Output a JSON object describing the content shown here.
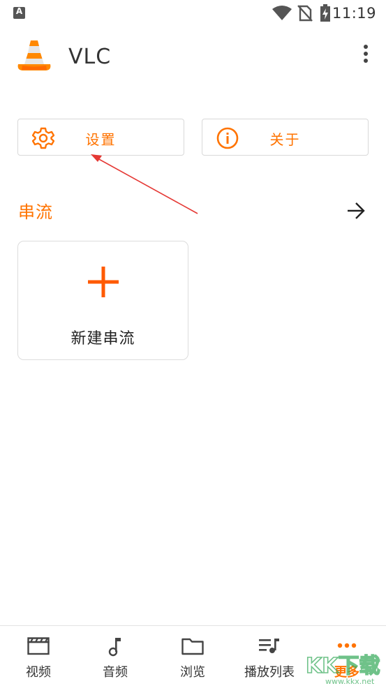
{
  "status_bar": {
    "time": "11:19"
  },
  "app_bar": {
    "title": "VLC"
  },
  "actions": {
    "settings_label": "设置",
    "about_label": "关于"
  },
  "section": {
    "title": "串流"
  },
  "stream_card": {
    "label": "新建串流"
  },
  "bottom_nav": {
    "items": [
      {
        "label": "视频",
        "icon": "video-icon"
      },
      {
        "label": "音频",
        "icon": "music-note-icon"
      },
      {
        "label": "浏览",
        "icon": "folder-icon"
      },
      {
        "label": "播放列表",
        "icon": "playlist-icon"
      },
      {
        "label": "更多",
        "icon": "more-dots-icon",
        "active": true
      }
    ]
  },
  "watermark": {
    "text": "KK下载",
    "url_text": "www.kkx.net"
  },
  "colors": {
    "accent": "#ff7300",
    "annotation": "#e53935"
  }
}
